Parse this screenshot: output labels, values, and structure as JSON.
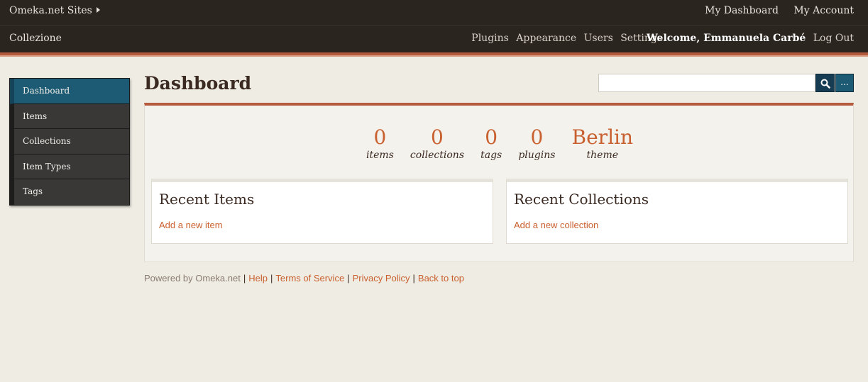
{
  "topbar": {
    "sites_label": "Omeka.net Sites",
    "my_dashboard": "My Dashboard",
    "my_account": "My Account"
  },
  "subbar": {
    "site_title": "Collezione",
    "nav": [
      "Plugins",
      "Appearance",
      "Users",
      "Settings"
    ],
    "welcome": "Welcome, Emmanuela Carbé",
    "logout": "Log Out"
  },
  "sidebar": {
    "items": [
      {
        "label": "Dashboard",
        "active": true
      },
      {
        "label": "Items"
      },
      {
        "label": "Collections"
      },
      {
        "label": "Item Types"
      },
      {
        "label": "Tags"
      }
    ]
  },
  "main": {
    "title": "Dashboard",
    "search": {
      "value": "",
      "placeholder": ""
    },
    "more_label": "...",
    "stats": [
      {
        "value": "0",
        "label": "items"
      },
      {
        "value": "0",
        "label": "collections"
      },
      {
        "value": "0",
        "label": "tags"
      },
      {
        "value": "0",
        "label": "plugins"
      },
      {
        "value": "Berlin",
        "label": "theme"
      }
    ],
    "recent_items": {
      "title": "Recent Items",
      "link": "Add a new item"
    },
    "recent_collections": {
      "title": "Recent Collections",
      "link": "Add a new collection"
    }
  },
  "footer": {
    "powered": "Powered by Omeka.net",
    "links": [
      "Help",
      "Terms of Service",
      "Privacy Policy",
      "Back to top"
    ]
  },
  "colors": {
    "header_bg": "#2b2520",
    "accent": "#b65a3d",
    "link": "#c9602f",
    "sidebar_active": "#1d5b74"
  }
}
